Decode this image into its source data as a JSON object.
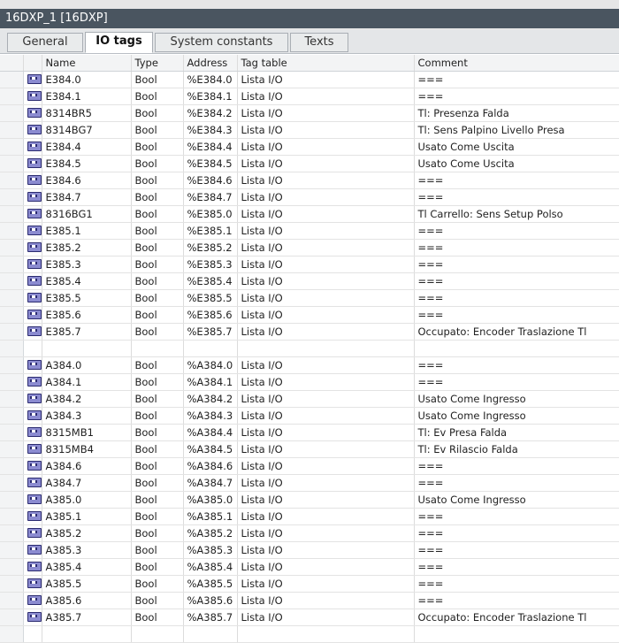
{
  "window": {
    "title": "16DXP_1 [16DXP]"
  },
  "tabs": [
    {
      "label": "General",
      "active": false
    },
    {
      "label": "IO tags",
      "active": true
    },
    {
      "label": "System constants",
      "active": false
    },
    {
      "label": "Texts",
      "active": false
    }
  ],
  "columns": [
    "Name",
    "Type",
    "Address",
    "Tag table",
    "Comment"
  ],
  "rows": [
    {
      "name": "E384.0",
      "type": "Bool",
      "address": "%E384.0",
      "tagtable": "Lista I/O",
      "comment": "==="
    },
    {
      "name": "E384.1",
      "type": "Bool",
      "address": "%E384.1",
      "tagtable": "Lista I/O",
      "comment": "==="
    },
    {
      "name": "8314BR5",
      "type": "Bool",
      "address": "%E384.2",
      "tagtable": "Lista I/O",
      "comment": "Tl: Presenza Falda"
    },
    {
      "name": "8314BG7",
      "type": "Bool",
      "address": "%E384.3",
      "tagtable": "Lista I/O",
      "comment": "Tl: Sens Palpino Livello Presa"
    },
    {
      "name": "E384.4",
      "type": "Bool",
      "address": "%E384.4",
      "tagtable": "Lista I/O",
      "comment": "Usato Come Uscita"
    },
    {
      "name": "E384.5",
      "type": "Bool",
      "address": "%E384.5",
      "tagtable": "Lista I/O",
      "comment": "Usato Come Uscita"
    },
    {
      "name": "E384.6",
      "type": "Bool",
      "address": "%E384.6",
      "tagtable": "Lista I/O",
      "comment": "==="
    },
    {
      "name": "E384.7",
      "type": "Bool",
      "address": "%E384.7",
      "tagtable": "Lista I/O",
      "comment": "==="
    },
    {
      "name": "8316BG1",
      "type": "Bool",
      "address": "%E385.0",
      "tagtable": "Lista I/O",
      "comment": "Tl Carrello: Sens Setup Polso"
    },
    {
      "name": "E385.1",
      "type": "Bool",
      "address": "%E385.1",
      "tagtable": "Lista I/O",
      "comment": "==="
    },
    {
      "name": "E385.2",
      "type": "Bool",
      "address": "%E385.2",
      "tagtable": "Lista I/O",
      "comment": "==="
    },
    {
      "name": "E385.3",
      "type": "Bool",
      "address": "%E385.3",
      "tagtable": "Lista I/O",
      "comment": "==="
    },
    {
      "name": "E385.4",
      "type": "Bool",
      "address": "%E385.4",
      "tagtable": "Lista I/O",
      "comment": "==="
    },
    {
      "name": "E385.5",
      "type": "Bool",
      "address": "%E385.5",
      "tagtable": "Lista I/O",
      "comment": "==="
    },
    {
      "name": "E385.6",
      "type": "Bool",
      "address": "%E385.6",
      "tagtable": "Lista I/O",
      "comment": "==="
    },
    {
      "name": "E385.7",
      "type": "Bool",
      "address": "%E385.7",
      "tagtable": "Lista I/O",
      "comment": "Occupato: Encoder Traslazione Tl"
    },
    {
      "empty": true
    },
    {
      "name": "A384.0",
      "type": "Bool",
      "address": "%A384.0",
      "tagtable": "Lista I/O",
      "comment": "==="
    },
    {
      "name": "A384.1",
      "type": "Bool",
      "address": "%A384.1",
      "tagtable": "Lista I/O",
      "comment": "==="
    },
    {
      "name": "A384.2",
      "type": "Bool",
      "address": "%A384.2",
      "tagtable": "Lista I/O",
      "comment": "Usato Come Ingresso"
    },
    {
      "name": "A384.3",
      "type": "Bool",
      "address": "%A384.3",
      "tagtable": "Lista I/O",
      "comment": "Usato Come Ingresso"
    },
    {
      "name": "8315MB1",
      "type": "Bool",
      "address": "%A384.4",
      "tagtable": "Lista I/O",
      "comment": "Tl: Ev Presa Falda"
    },
    {
      "name": "8315MB4",
      "type": "Bool",
      "address": "%A384.5",
      "tagtable": "Lista I/O",
      "comment": "Tl: Ev Rilascio Falda"
    },
    {
      "name": "A384.6",
      "type": "Bool",
      "address": "%A384.6",
      "tagtable": "Lista I/O",
      "comment": "==="
    },
    {
      "name": "A384.7",
      "type": "Bool",
      "address": "%A384.7",
      "tagtable": "Lista I/O",
      "comment": "==="
    },
    {
      "name": "A385.0",
      "type": "Bool",
      "address": "%A385.0",
      "tagtable": "Lista I/O",
      "comment": "Usato Come Ingresso"
    },
    {
      "name": "A385.1",
      "type": "Bool",
      "address": "%A385.1",
      "tagtable": "Lista I/O",
      "comment": "==="
    },
    {
      "name": "A385.2",
      "type": "Bool",
      "address": "%A385.2",
      "tagtable": "Lista I/O",
      "comment": "==="
    },
    {
      "name": "A385.3",
      "type": "Bool",
      "address": "%A385.3",
      "tagtable": "Lista I/O",
      "comment": "==="
    },
    {
      "name": "A385.4",
      "type": "Bool",
      "address": "%A385.4",
      "tagtable": "Lista I/O",
      "comment": "==="
    },
    {
      "name": "A385.5",
      "type": "Bool",
      "address": "%A385.5",
      "tagtable": "Lista I/O",
      "comment": "==="
    },
    {
      "name": "A385.6",
      "type": "Bool",
      "address": "%A385.6",
      "tagtable": "Lista I/O",
      "comment": "==="
    },
    {
      "name": "A385.7",
      "type": "Bool",
      "address": "%A385.7",
      "tagtable": "Lista I/O",
      "comment": "Occupato: Encoder Traslazione Tl"
    },
    {
      "empty": true
    }
  ]
}
